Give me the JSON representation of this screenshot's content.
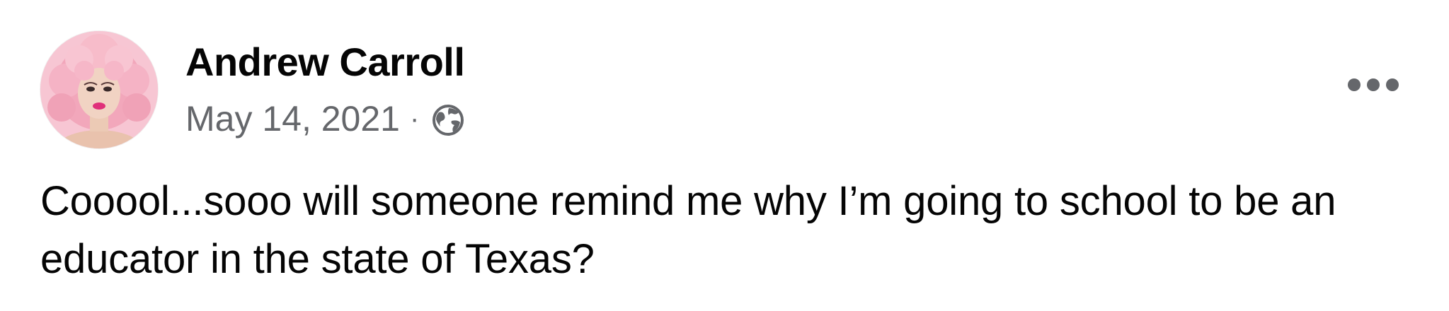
{
  "post": {
    "author_name": "Andrew Carroll",
    "date": "May 14, 2021",
    "separator": "·",
    "audience_icon": "globe-icon",
    "more_icon": "more-horizontal-icon",
    "text": "Cooool...sooo will someone remind me why I’m going to school to be an educator in the state of Texas?"
  },
  "colors": {
    "primary_text": "#050505",
    "secondary_text": "#65676b",
    "avatar_bg": "#f4bccb"
  }
}
